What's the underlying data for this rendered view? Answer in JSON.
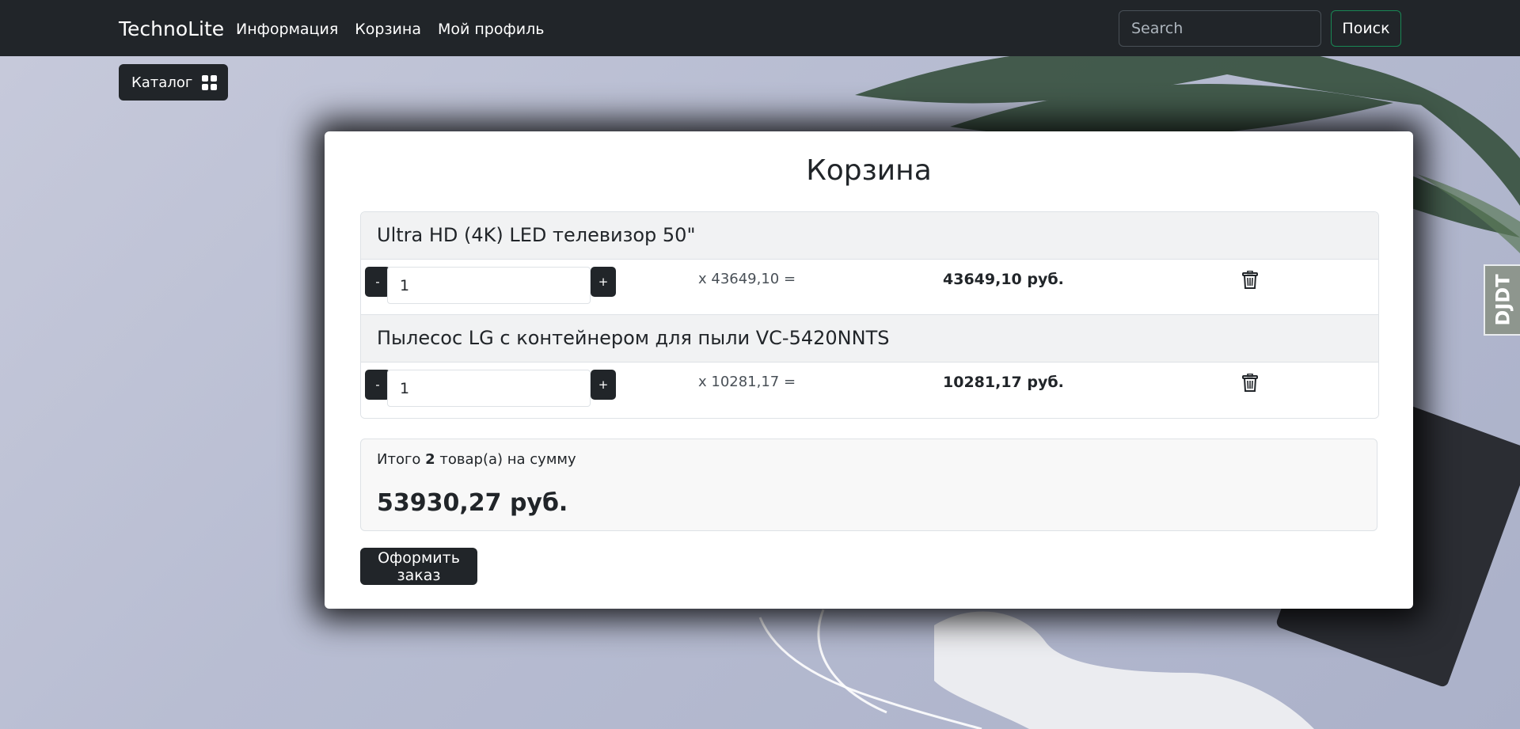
{
  "navbar": {
    "brand": "TechnoLite",
    "links": [
      "Информация",
      "Корзина",
      "Мой профиль"
    ],
    "search_placeholder": "Search",
    "search_button": "Поиск"
  },
  "catalog_button": {
    "label": "Каталог",
    "icon": "grid-icon"
  },
  "side_badge": {
    "text": "DJDT"
  },
  "cart": {
    "title": "Корзина",
    "items": [
      {
        "name": "Ultra HD (4K) LED телевизор 50\"",
        "minus": "-",
        "plus": "+",
        "quantity": "1",
        "unit_price": "x 43649,10 =",
        "line_total": "43649,10 руб.",
        "delete_icon": "trash-icon"
      },
      {
        "name": "Пылесос LG с контейнером для пыли VC-5420NNTS",
        "minus": "-",
        "plus": "+",
        "quantity": "1",
        "unit_price": "x 10281,17 =",
        "line_total": "10281,17 руб.",
        "delete_icon": "trash-icon"
      }
    ],
    "summary": {
      "prefix": "Итого ",
      "count": "2",
      "suffix": " товар(а) на сумму",
      "total": "53930,27 руб."
    },
    "checkout_button": "Оформить заказ"
  },
  "colors": {
    "navbar": "#212529",
    "search_button_border": "#198754",
    "background": "#bfc3d6"
  }
}
